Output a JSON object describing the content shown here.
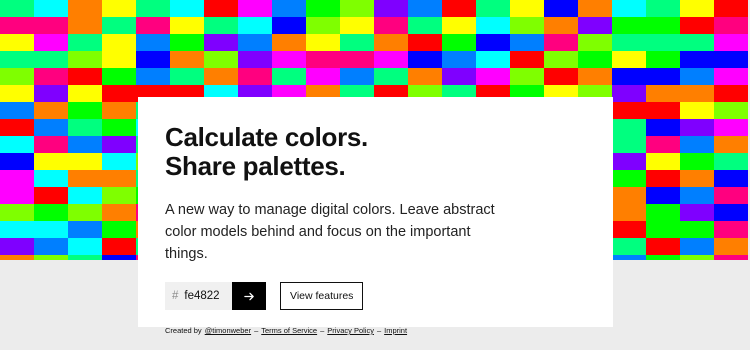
{
  "hero": {
    "headline_line1": "Calculate colors.",
    "headline_line2": "Share palettes.",
    "lead": "A new way to manage digital colors. Leave abstract color models behind and focus on the important things."
  },
  "color_input": {
    "hash": "#",
    "value": "fe4822"
  },
  "actions": {
    "features_label": "View features"
  },
  "footer": {
    "created_by": "Created by",
    "author_link": "@timonweber",
    "sep1": "–",
    "terms": "Terms of Service",
    "sep2": "–",
    "privacy": "Privacy Policy",
    "sep3": "–",
    "imprint": "Imprint"
  },
  "colors": {
    "background": "#ececec",
    "card": "#ffffff",
    "button": "#000000",
    "mosaic_palette": [
      "#ff0000",
      "#ff7f00",
      "#ffff00",
      "#7fff00",
      "#00ff00",
      "#00ff7f",
      "#00ffff",
      "#007fff",
      "#0000ff",
      "#7f00ff",
      "#ff00ff",
      "#ff007f"
    ]
  },
  "icons": {
    "go": "arrow-right-icon"
  }
}
